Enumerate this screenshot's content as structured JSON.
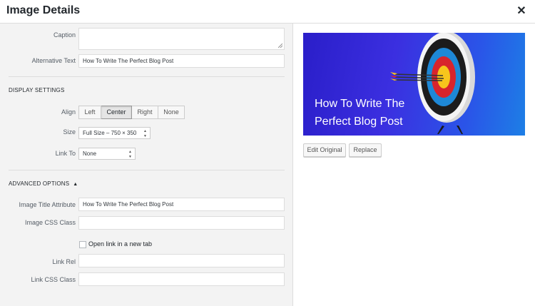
{
  "header": {
    "title": "Image Details"
  },
  "form": {
    "caption_label": "Caption",
    "caption_value": "",
    "alt_label": "Alternative Text",
    "alt_value": "How To Write The Perfect Blog Post",
    "display_section": "DISPLAY SETTINGS",
    "align_label": "Align",
    "align_options": [
      "Left",
      "Center",
      "Right",
      "None"
    ],
    "align_selected": "Center",
    "size_label": "Size",
    "size_value": "Full Size – 750 × 350",
    "link_label": "Link To",
    "link_value": "None",
    "advanced_section": "ADVANCED OPTIONS",
    "title_attr_label": "Image Title Attribute",
    "title_attr_value": "How To Write The Perfect Blog Post",
    "css_class_label": "Image CSS Class",
    "css_class_value": "",
    "new_tab_label": "Open link in a new tab",
    "new_tab_checked": false,
    "link_rel_label": "Link Rel",
    "link_rel_value": "",
    "link_css_label": "Link CSS Class",
    "link_css_value": ""
  },
  "preview": {
    "text": "How To Write The Perfect Blog Post",
    "edit_button": "Edit Original",
    "replace_button": "Replace"
  }
}
